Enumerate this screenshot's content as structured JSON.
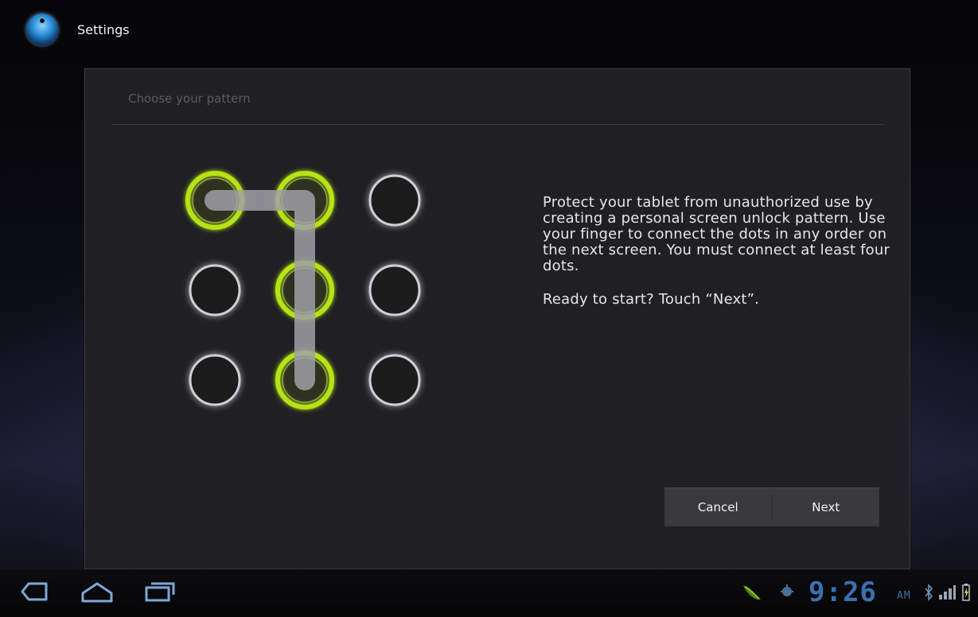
{
  "app_bar": {
    "title": "Settings",
    "icon": "settings-app-icon"
  },
  "dialog": {
    "title": "Choose your pattern",
    "description": [
      "Protect your tablet from unauthorized use by creating a personal screen unlock pattern. Use your finger to connect the dots in any order on the next screen. You must connect at least four dots.",
      "Ready to start? Touch “Next”."
    ],
    "pattern": {
      "grid": [
        3,
        3
      ],
      "selected_dots": [
        [
          0,
          0
        ],
        [
          0,
          1
        ],
        [
          1,
          1
        ],
        [
          2,
          1
        ]
      ],
      "connected_path": [
        [
          0,
          0
        ],
        [
          0,
          1
        ],
        [
          1,
          1
        ],
        [
          2,
          1
        ]
      ],
      "selected_color": "#b6e312",
      "idle_color": "#cfcfd4"
    },
    "buttons": {
      "cancel": "Cancel",
      "next": "Next"
    }
  },
  "system_bar": {
    "nav_icons": [
      "back-icon",
      "home-icon",
      "recent-apps-icon"
    ],
    "notification_icons": [
      "android-notification-icon",
      "usb-debugging-icon"
    ],
    "clock": "9:26",
    "ampm": "AM",
    "status_icons": [
      "bluetooth-icon",
      "signal-icon",
      "battery-icon"
    ],
    "accent_color": "#3b6fb1"
  }
}
